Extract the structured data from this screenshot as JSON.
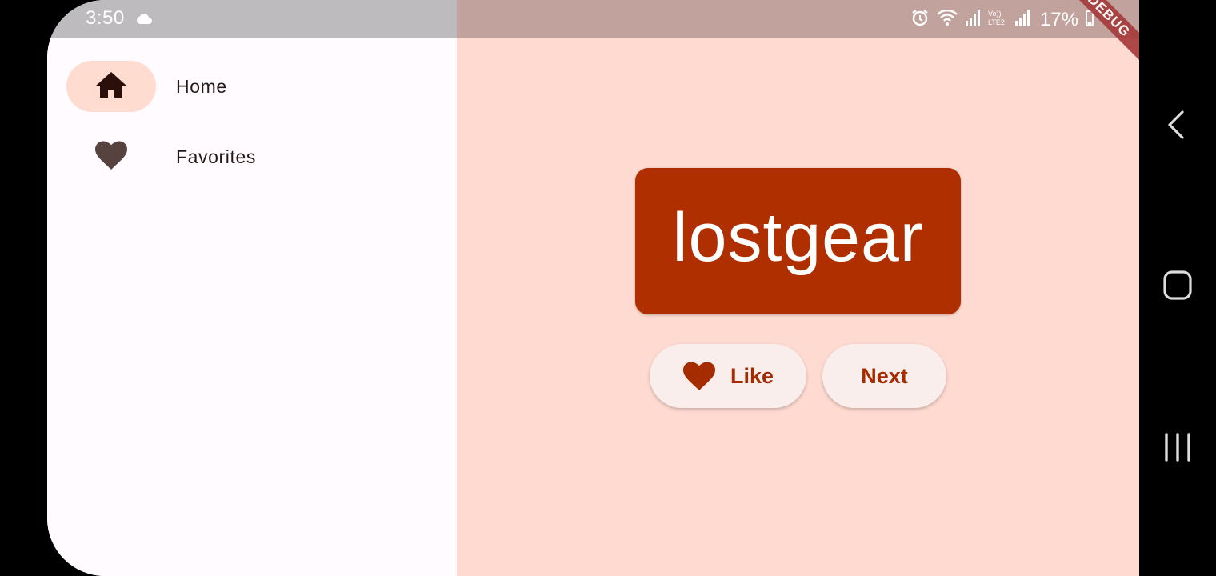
{
  "status_bar": {
    "time": "3:50",
    "battery": "17%",
    "icons": [
      "cloud-icon",
      "alarm-icon",
      "wifi-icon",
      "signal-icon",
      "volte-icon",
      "signal-icon",
      "battery-icon"
    ]
  },
  "debug_banner": "DEBUG",
  "rail": {
    "items": [
      {
        "label": "Home",
        "icon": "home-icon",
        "selected": true
      },
      {
        "label": "Favorites",
        "icon": "heart-icon",
        "selected": false
      }
    ]
  },
  "main": {
    "word": "lostgear",
    "like_button": "Like",
    "next_button": "Next"
  },
  "colors": {
    "primary": "#B02F00",
    "content_background": "#FFDAD0",
    "rail_background": "#FFFBFE",
    "selected_indicator": "#FFDBD0",
    "button_background": "#FAEEEC"
  },
  "system_nav": [
    "back-icon",
    "home-button-icon",
    "recents-icon"
  ]
}
